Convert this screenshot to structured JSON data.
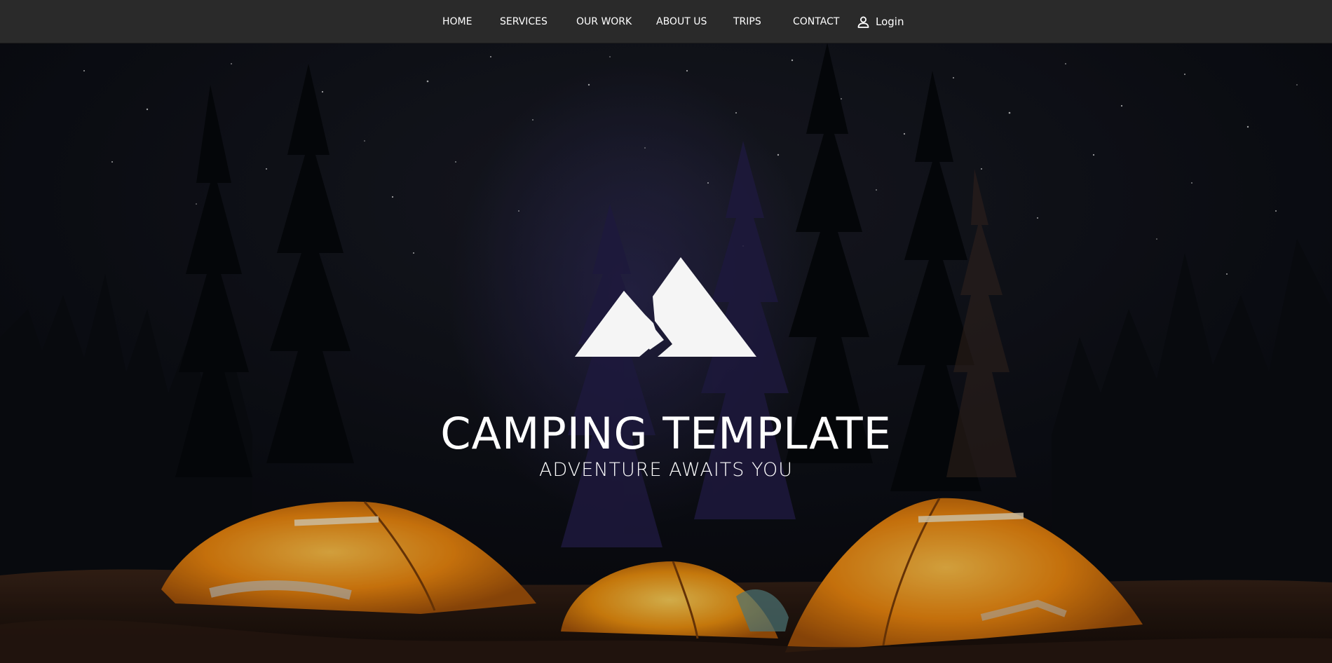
{
  "nav": {
    "items": [
      {
        "label": "HOME"
      },
      {
        "label": "SERVICES"
      },
      {
        "label": "OUR WORK"
      },
      {
        "label": "ABOUT US"
      },
      {
        "label": "TRIPS"
      },
      {
        "label": "CONTACT"
      }
    ],
    "login": {
      "label": "Login",
      "icon": "user-icon"
    }
  },
  "hero": {
    "logo_icon": "mountain-icon",
    "title": "CAMPING TEMPLATE",
    "subtitle": "ADVENTURE AWAITS YOU"
  },
  "colors": {
    "navbar": "#2a2a2a",
    "text": "#ffffff",
    "sky": "#0b0d14",
    "tent": "#f08a10"
  }
}
